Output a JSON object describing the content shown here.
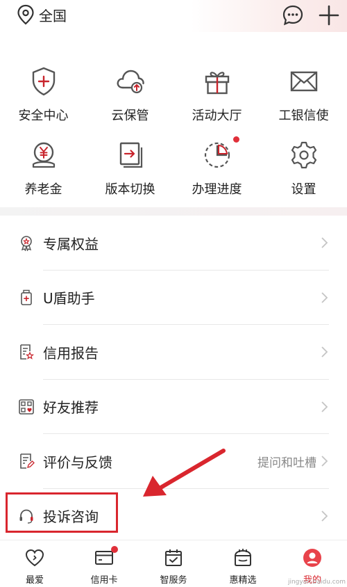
{
  "header": {
    "location": "全国"
  },
  "grid": [
    {
      "label": "安全中心",
      "icon": "shield-plus-icon"
    },
    {
      "label": "云保管",
      "icon": "cloud-upload-icon"
    },
    {
      "label": "活动大厅",
      "icon": "gift-icon"
    },
    {
      "label": "工银信使",
      "icon": "envelope-icon"
    },
    {
      "label": "养老金",
      "icon": "pension-yen-icon"
    },
    {
      "label": "版本切换",
      "icon": "switch-version-icon"
    },
    {
      "label": "办理进度",
      "icon": "progress-pie-icon",
      "badge": true
    },
    {
      "label": "设置",
      "icon": "gear-icon"
    }
  ],
  "list": [
    {
      "label": "专属权益",
      "icon": "ribbon-badge-icon",
      "right": ""
    },
    {
      "label": "U盾助手",
      "icon": "ushield-icon",
      "right": ""
    },
    {
      "label": "信用报告",
      "icon": "report-icon",
      "right": ""
    },
    {
      "label": "好友推荐",
      "icon": "qr-recommend-icon",
      "right": ""
    },
    {
      "label": "评价与反馈",
      "icon": "feedback-icon",
      "right": "提问和吐槽"
    },
    {
      "label": "投诉咨询",
      "icon": "headset-icon",
      "right": ""
    }
  ],
  "bottom_nav": [
    {
      "label": "最爱",
      "icon": "heart-icon"
    },
    {
      "label": "信用卡",
      "icon": "credit-card-icon",
      "badge": true
    },
    {
      "label": "智服务",
      "icon": "calendar-check-icon"
    },
    {
      "label": "惠精选",
      "icon": "shopping-bag-icon"
    },
    {
      "label": "我的",
      "icon": "profile-icon",
      "active": true
    }
  ],
  "watermark": "jingyan.baidu.com",
  "colors": {
    "accent": "#d9262e",
    "icon": "#555555",
    "text": "#222222",
    "muted": "#888888"
  }
}
